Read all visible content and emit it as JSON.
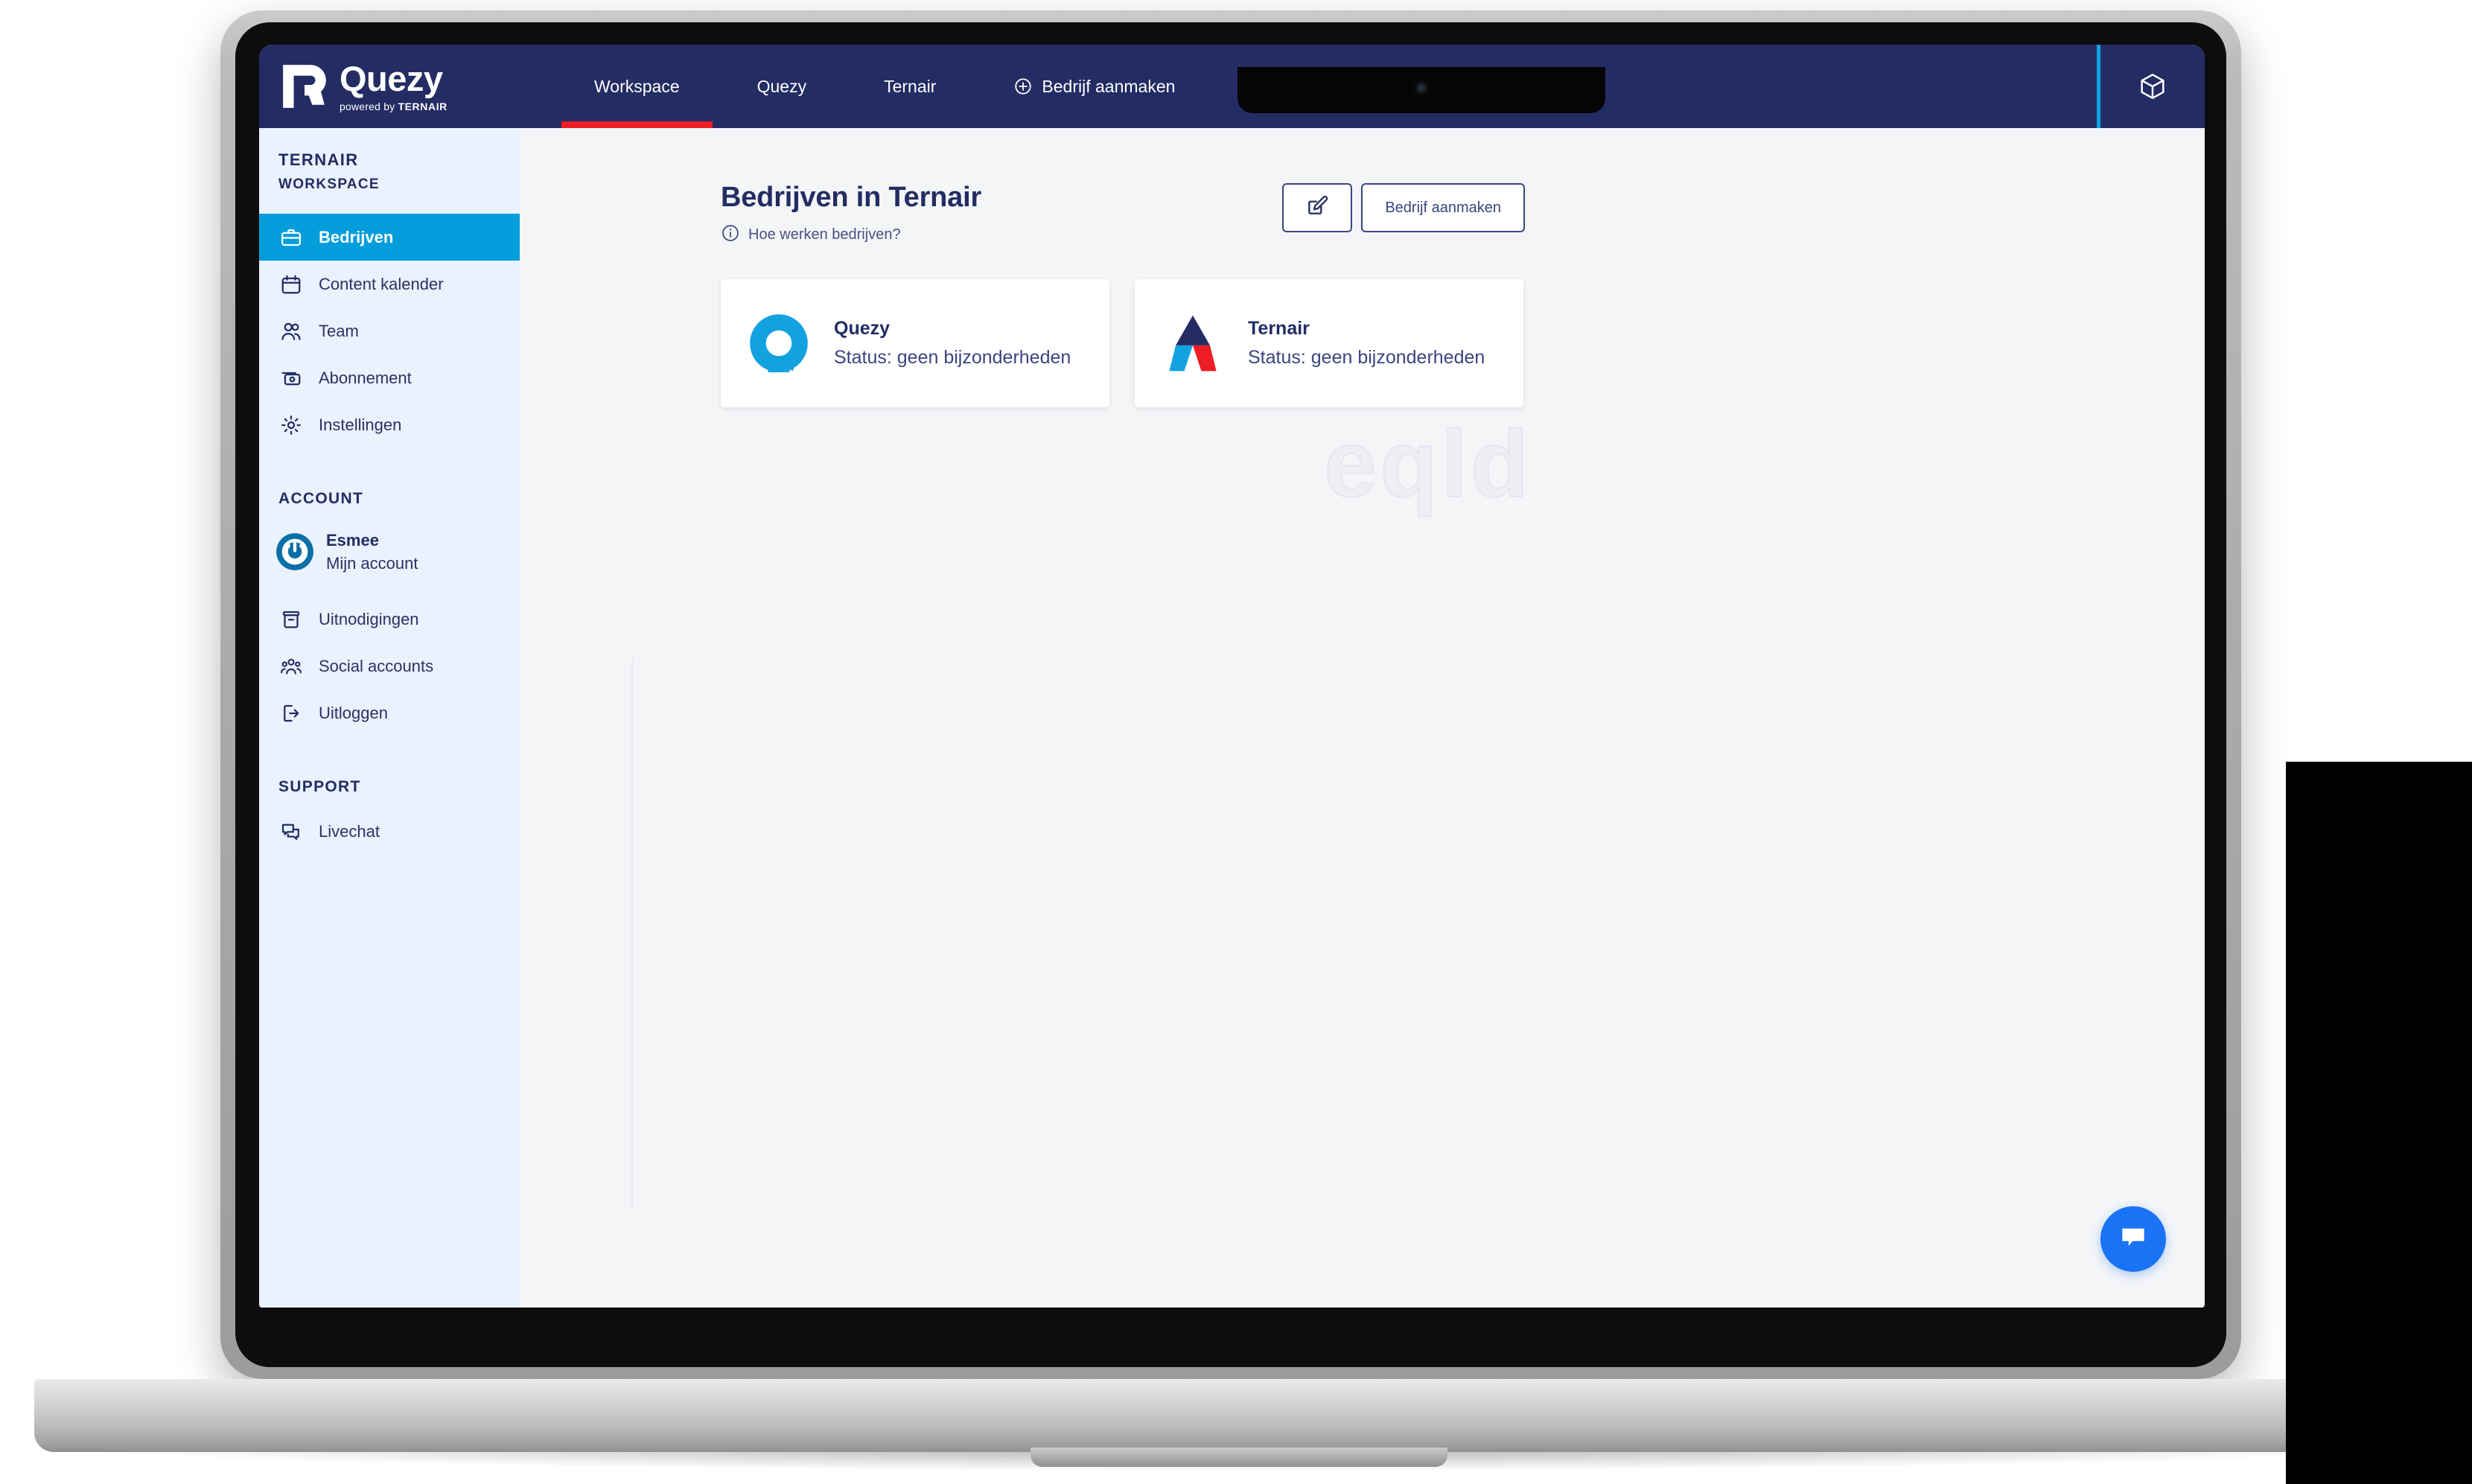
{
  "navbar": {
    "brand_name": "Quezy",
    "brand_sub_pre": "powered by ",
    "brand_sub_bold": "TERNAIR",
    "brand_mark_icon": "quezy-q-logo-icon",
    "tabs": [
      {
        "label": "Workspace",
        "active": true,
        "icon": null
      },
      {
        "label": "Quezy",
        "active": false,
        "icon": null
      },
      {
        "label": "Ternair",
        "active": false,
        "icon": null
      },
      {
        "label": "Bedrijf aanmaken",
        "active": false,
        "icon": "plus-circle-icon"
      }
    ],
    "right_icon": "cube-icon",
    "accent_red": "#ee1d25",
    "accent_cyan": "#13a2e0",
    "background": "#232c63"
  },
  "sidebar": {
    "workspace_name": "TERNAIR",
    "workspace_label": "WORKSPACE",
    "nav_items": [
      {
        "label": "Bedrijven",
        "icon": "briefcase-icon",
        "active": true
      },
      {
        "label": "Content kalender",
        "icon": "calendar-icon",
        "active": false
      },
      {
        "label": "Team",
        "icon": "users-icon",
        "active": false
      },
      {
        "label": "Abonnement",
        "icon": "subscription-card-icon",
        "active": false
      },
      {
        "label": "Instellingen",
        "icon": "gear-icon",
        "active": false
      }
    ],
    "account_section_label": "ACCOUNT",
    "account": {
      "name": "Esmee",
      "subtitle": "Mijn account",
      "avatar_icon": "power-avatar-icon"
    },
    "account_items": [
      {
        "label": "Uitnodigingen",
        "icon": "inbox-icon"
      },
      {
        "label": "Social accounts",
        "icon": "people-group-icon"
      },
      {
        "label": "Uitloggen",
        "icon": "logout-icon"
      }
    ],
    "support_section_label": "SUPPORT",
    "support_items": [
      {
        "label": "Livechat",
        "icon": "chat-bubbles-icon"
      }
    ],
    "background": "#e9f2fd",
    "active_color": "#039ddb"
  },
  "main": {
    "page_title": "Bedrijven in Ternair",
    "help_link": "Hoe werken bedrijven?",
    "help_icon": "info-circle-icon",
    "edit_button_icon": "edit-square-icon",
    "create_button_label": "Bedrijf aanmaken",
    "watermark_text": "eqld",
    "companies": [
      {
        "name": "Quezy",
        "status": "Status: geen bijzonderheden",
        "logo_icon": "quezy-logo-icon"
      },
      {
        "name": "Ternair",
        "status": "Status: geen bijzonderheden",
        "logo_icon": "ternair-triangle-logo-icon"
      }
    ],
    "chat_fab_icon": "chat-bubble-icon",
    "background": "#f4f5f7"
  }
}
